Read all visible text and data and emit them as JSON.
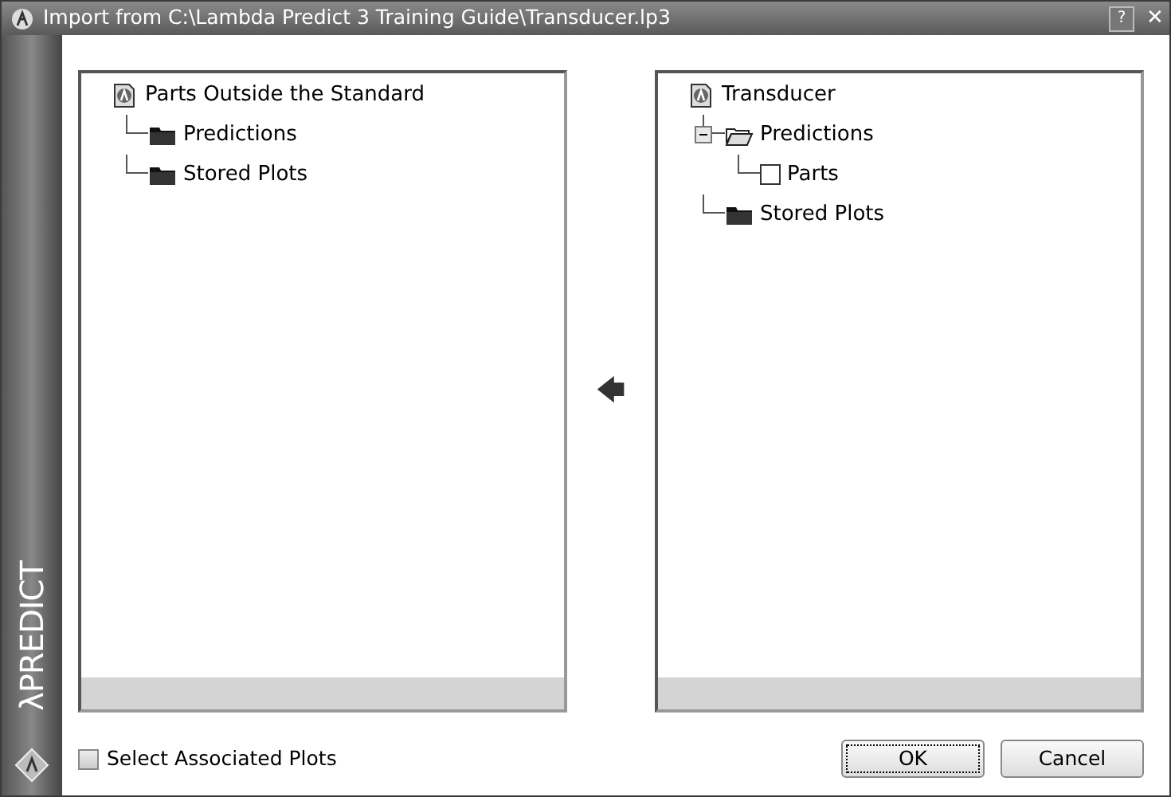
{
  "window": {
    "title": "Import from C:\\Lambda Predict 3 Training Guide\\Transducer.lp3",
    "help_button": "?",
    "close_button": "✕"
  },
  "brand": {
    "symbol": "λ",
    "text": "PREDICT"
  },
  "left_tree": {
    "label": "Parts Outside the Standard",
    "children": [
      {
        "kind": "folder",
        "label": "Predictions"
      },
      {
        "kind": "folder",
        "label": "Stored Plots"
      }
    ]
  },
  "move_arrow": "🡄",
  "right_tree": {
    "label": "Transducer",
    "children": [
      {
        "kind": "folder",
        "label": "Predictions",
        "expanded": true,
        "children": [
          {
            "kind": "checkbox",
            "label": "Parts",
            "checked": false
          }
        ]
      },
      {
        "kind": "folder",
        "label": "Stored Plots"
      }
    ]
  },
  "select_associated": {
    "label": "Select Associated Plots",
    "checked": false
  },
  "buttons": [
    {
      "label": "OK",
      "default": true
    },
    {
      "label": "Cancel",
      "default": false
    }
  ]
}
